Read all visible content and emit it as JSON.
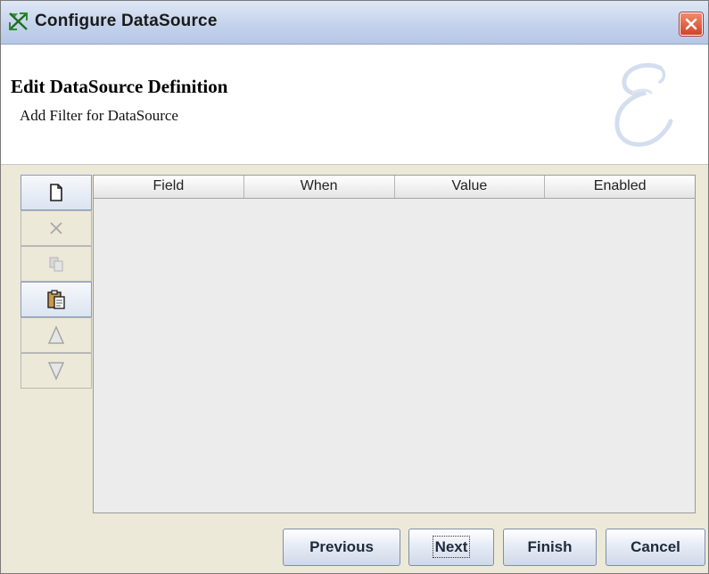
{
  "window": {
    "title": "Configure DataSource"
  },
  "header": {
    "title": "Edit DataSource Definition",
    "subtitle": "Add Filter for DataSource"
  },
  "toolbar": {
    "buttons": [
      {
        "icon": "new-document-icon",
        "enabled": true
      },
      {
        "icon": "delete-x-icon",
        "enabled": false
      },
      {
        "icon": "copy-icon",
        "enabled": false
      },
      {
        "icon": "paste-icon",
        "enabled": true
      },
      {
        "icon": "move-up-icon",
        "enabled": false
      },
      {
        "icon": "move-down-icon",
        "enabled": false
      }
    ]
  },
  "table": {
    "columns": [
      "Field",
      "When",
      "Value",
      "Enabled"
    ],
    "rows": []
  },
  "buttons": {
    "previous": "Previous",
    "next": "Next",
    "finish": "Finish",
    "cancel": "Cancel"
  },
  "colors": {
    "titlebar": "#c4d3ec",
    "dialog_bg": "#ece9d8",
    "close_button": "#d2432a"
  }
}
